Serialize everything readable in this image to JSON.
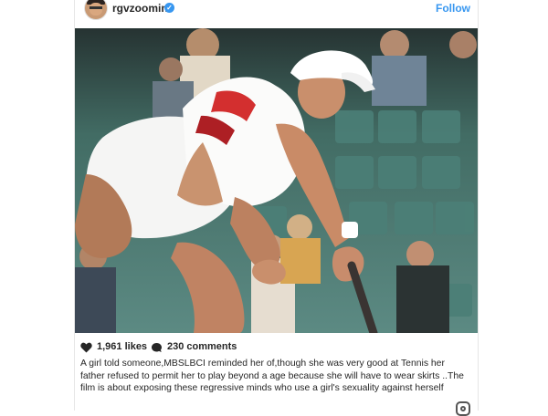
{
  "header": {
    "username": "rgvzoomin",
    "verified_icon": "verified-check-icon",
    "follow_label": "Follow"
  },
  "photo": {
    "description_icon": "tennis-photo"
  },
  "actions": {
    "likes": "1,961 likes",
    "comments": "230 comments",
    "like_icon": "heart-icon",
    "comment_icon": "comment-bubble-icon"
  },
  "caption": {
    "text": "A girl told someone,MBSLBCI reminded her of,though she was very good at Tennis her father refused to permit her to play beyond a age because she will have to wear skirts ..The film is about exposing these regressive minds who use a girl's sexuality against herself"
  },
  "colors": {
    "accent": "#3897f0",
    "text": "#262626",
    "stadium_seats": "#3f6a63"
  }
}
